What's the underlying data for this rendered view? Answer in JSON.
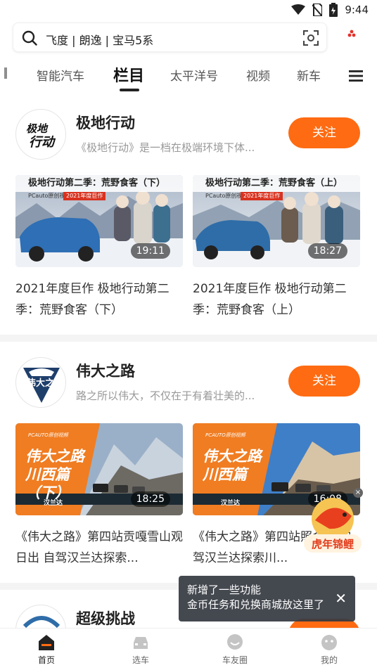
{
  "status_bar": {
    "time": "9:44"
  },
  "search": {
    "placeholder": "飞度 | 朗逸 | 宝马5系"
  },
  "tabs": [
    {
      "label": "智能汽车"
    },
    {
      "label": "栏目"
    },
    {
      "label": "太平洋号"
    },
    {
      "label": "视频"
    },
    {
      "label": "新车"
    }
  ],
  "channels": [
    {
      "name": "极地行动",
      "description": "《极地行动》是一档在极端环境下体...",
      "follow_label": "关注",
      "avatar_text": "极地行动",
      "videos": [
        {
          "banner": "极地行动第二季：荒野食客（下）",
          "brand": "PCauto原创视频",
          "tag": "2021年度巨作",
          "duration": "19:11",
          "title": "2021年度巨作 极地行动第二季：荒野食客（下）"
        },
        {
          "banner": "极地行动第二季：荒野食客（上）",
          "brand": "PCauto原创视频",
          "tag": "2021年度巨作",
          "duration": "18:27",
          "title": "2021年度巨作 极地行动第二季：荒野食客（上）"
        }
      ]
    },
    {
      "name": "伟大之路",
      "description": "路之所以伟大，不仅在于有着壮美的...",
      "follow_label": "关注",
      "avatar_text": "伟大之路",
      "videos": [
        {
          "overlay_label": "PCAUTO原创视频",
          "overlay_title": "伟大之路川西篇（下）",
          "logo": "汉兰达",
          "duration": "18:25",
          "title": "《伟大之路》第四站贡嘎雪山观日出 自驾汉兰达探索..."
        },
        {
          "overlay_label": "PCAUTO原创视频",
          "overlay_title": "伟大之路川西篇",
          "logo": "汉兰达",
          "duration": "16:08",
          "title": "《伟大之路》第四站照金山 自驾汉兰达探索川..."
        }
      ]
    },
    {
      "name": "超级挑战"
    }
  ],
  "promo_badge": {
    "text": "虎年锦鲤"
  },
  "toast": {
    "line1": "新增了一些功能",
    "line2": "金币任务和兑换商城放这里了",
    "close": "✕"
  },
  "bottom_nav": [
    {
      "label": "首页",
      "icon": "home-icon"
    },
    {
      "label": "选车",
      "icon": "car-icon"
    },
    {
      "label": "车友圈",
      "icon": "chat-icon"
    },
    {
      "label": "我的",
      "icon": "profile-icon"
    }
  ],
  "colors": {
    "accent": "#fe6b12",
    "toast_bg": "#363a42"
  }
}
